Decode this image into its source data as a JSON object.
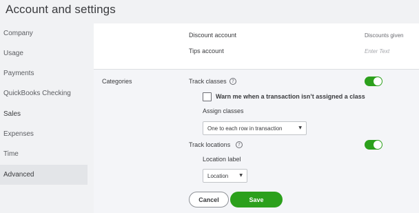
{
  "header": {
    "title": "Account and settings"
  },
  "sidebar": {
    "items": [
      {
        "label": "Company"
      },
      {
        "label": "Usage"
      },
      {
        "label": "Payments"
      },
      {
        "label": "QuickBooks Checking"
      },
      {
        "label": "Sales"
      },
      {
        "label": "Expenses"
      },
      {
        "label": "Time"
      },
      {
        "label": "Advanced"
      }
    ],
    "active_index": 7
  },
  "main": {
    "discount_account": {
      "label": "Discount account",
      "value": "Discounts given"
    },
    "tips_account": {
      "label": "Tips account",
      "placeholder": "Enter Text"
    },
    "categories": {
      "title": "Categories",
      "track_classes": {
        "label": "Track classes",
        "enabled": true
      },
      "warn_checkbox": {
        "label": "Warn me when a transaction isn’t assigned a class",
        "checked": false
      },
      "assign_classes": {
        "label": "Assign classes",
        "selected": "One to each row in transaction"
      },
      "track_locations": {
        "label": "Track locations",
        "enabled": true
      },
      "location_label": {
        "label": "Location label",
        "selected": "Location"
      }
    },
    "buttons": {
      "cancel": "Cancel",
      "save": "Save"
    }
  },
  "icons": {
    "info": "info-icon",
    "dropdown": "caret-down-icon"
  },
  "colors": {
    "accent": "#2ca01c",
    "background": "#f1f2f4",
    "section_bg": "#f4f5f8"
  }
}
